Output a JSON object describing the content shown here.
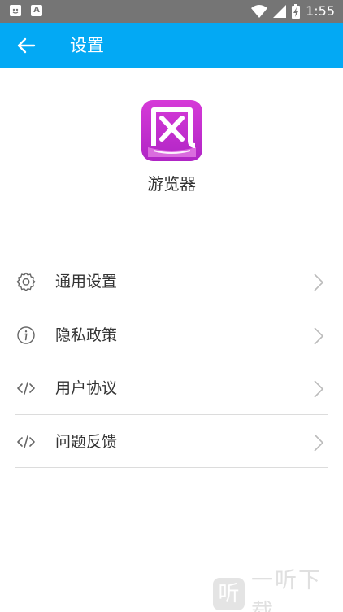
{
  "status_bar": {
    "time": "1:55",
    "notif_icon_1": "A",
    "notif_icon_2": "A"
  },
  "app_bar": {
    "title": "设置"
  },
  "app": {
    "name": "游览器",
    "logo_glyph": "风"
  },
  "menu": [
    {
      "label": "通用设置",
      "icon": "gear-icon"
    },
    {
      "label": "隐私政策",
      "icon": "info-icon"
    },
    {
      "label": "用户协议",
      "icon": "code-icon"
    },
    {
      "label": "问题反馈",
      "icon": "code-icon"
    }
  ],
  "watermark": {
    "glyph": "听",
    "text": "一听下载"
  },
  "colors": {
    "accent": "#03A9F4",
    "status_bar": "#757575",
    "logo_start": "#d63ad8",
    "logo_end": "#b025c5"
  }
}
